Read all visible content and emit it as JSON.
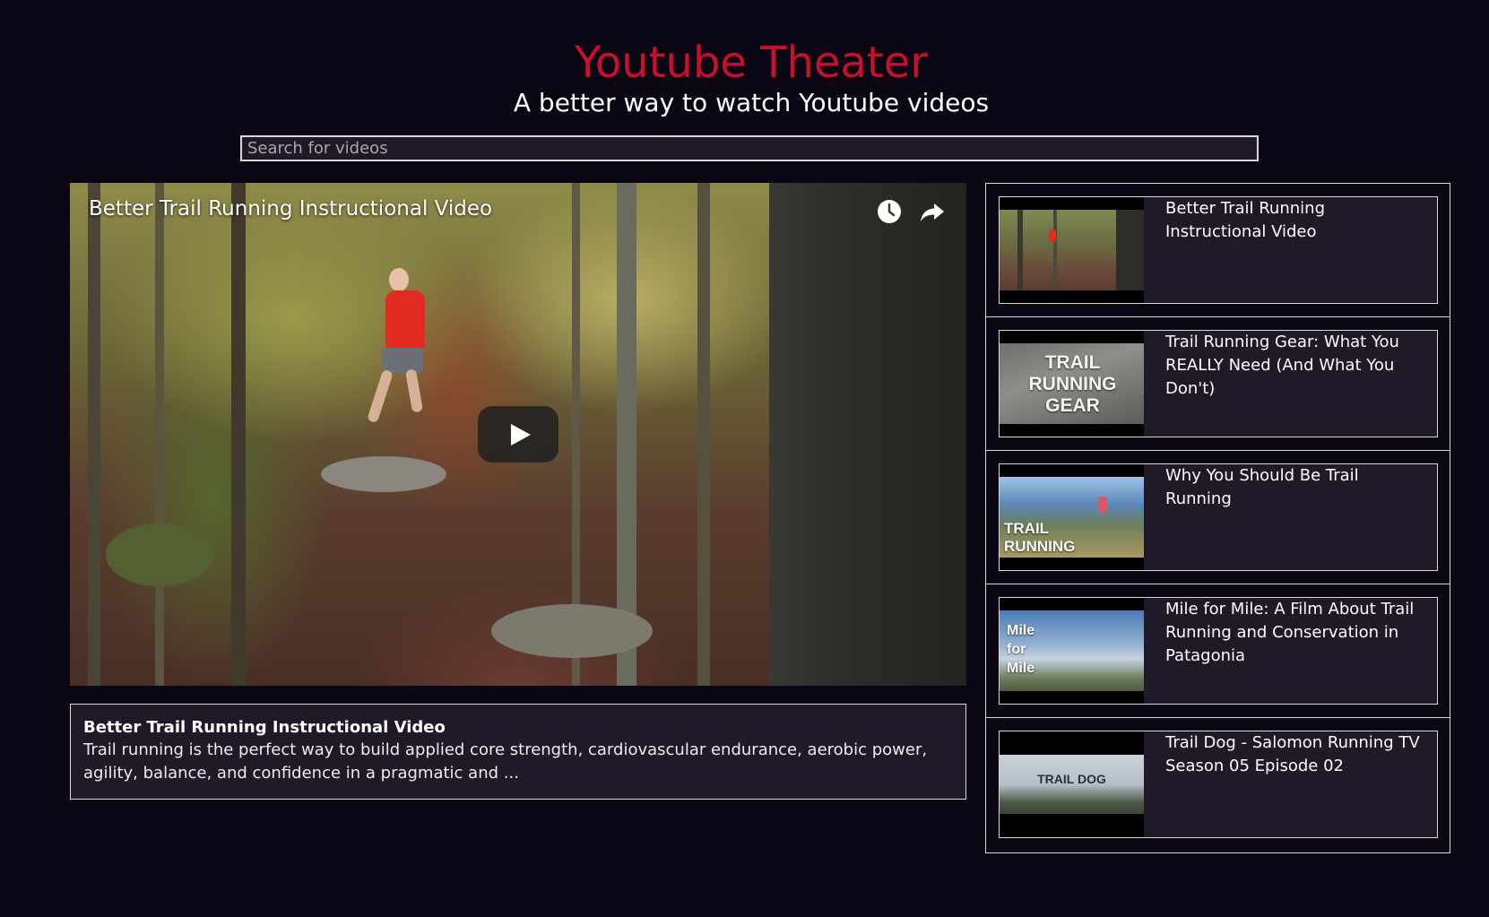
{
  "header": {
    "title": "Youtube Theater",
    "subtitle": "A better way to watch Youtube videos"
  },
  "search": {
    "placeholder": "Search for videos",
    "value": ""
  },
  "player": {
    "title": "Better Trail Running Instructional Video",
    "icons": {
      "watch_later": "clock-icon",
      "share": "share-icon",
      "play": "play-icon"
    }
  },
  "description": {
    "title": "Better Trail Running Instructional Video",
    "text": "Trail running is the perfect way to build applied core strength, cardiovascular endurance, aerobic power, agility, balance, and confidence in a pragmatic and ..."
  },
  "videos": [
    {
      "title": "Better Trail Running Instructional Video",
      "thumb_text": ""
    },
    {
      "title": "Trail Running Gear: What You REALLY Need (And What You Don't)",
      "thumb_text": "TRAIL RUNNING GEAR"
    },
    {
      "title": "Why You Should Be Trail Running",
      "thumb_text": "TRAIL RUNNING"
    },
    {
      "title": "Mile for Mile: A Film About Trail Running and Conservation in Patagonia",
      "thumb_text": "Mile for Mile"
    },
    {
      "title": "Trail Dog - Salomon Running TV Season 05 Episode 02",
      "thumb_text": "TRAIL DOG"
    }
  ],
  "colors": {
    "background": "#0b0614",
    "accent": "#c8102e",
    "panel": "#201a28",
    "border": "#d8d8d8"
  }
}
